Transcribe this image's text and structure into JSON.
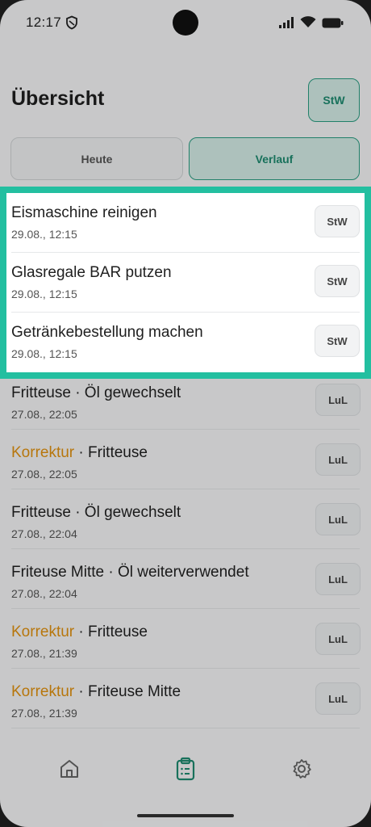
{
  "status": {
    "time": "12:17"
  },
  "header": {
    "title": "Übersicht",
    "user_badge": "StW"
  },
  "tabs": [
    {
      "label": "Heute"
    },
    {
      "label": "Verlauf"
    }
  ],
  "highlighted_items": [
    {
      "title": "Eismaschine reinigen",
      "time": "29.08., 12:15",
      "user": "StW"
    },
    {
      "title": "Glasregale BAR putzen",
      "time": "29.08., 12:15",
      "user": "StW"
    },
    {
      "title": "Getränkebestellung machen",
      "time": "29.08., 12:15",
      "user": "StW"
    }
  ],
  "items": [
    {
      "prefix": "",
      "title": "Fritteuse · Öl gewechselt",
      "time": "27.08., 22:05",
      "user": "LuL"
    },
    {
      "prefix": "Korrektur",
      "title": " · Fritteuse",
      "time": "27.08., 22:05",
      "user": "LuL"
    },
    {
      "prefix": "",
      "title": "Fritteuse · Öl gewechselt",
      "time": "27.08., 22:04",
      "user": "LuL"
    },
    {
      "prefix": "",
      "title": "Friteuse Mitte · Öl weiterverwendet",
      "time": "27.08., 22:04",
      "user": "LuL"
    },
    {
      "prefix": "Korrektur",
      "title": " · Fritteuse",
      "time": "27.08., 21:39",
      "user": "LuL"
    },
    {
      "prefix": "Korrektur",
      "title": " · Friteuse Mitte",
      "time": "27.08., 21:39",
      "user": "LuL"
    }
  ],
  "nav": [
    {
      "icon": "home-icon"
    },
    {
      "icon": "clipboard-icon"
    },
    {
      "icon": "settings-icon"
    }
  ],
  "colors": {
    "accent": "#2a9d82",
    "highlight": "#23bfa0",
    "correction": "#e0900f"
  }
}
